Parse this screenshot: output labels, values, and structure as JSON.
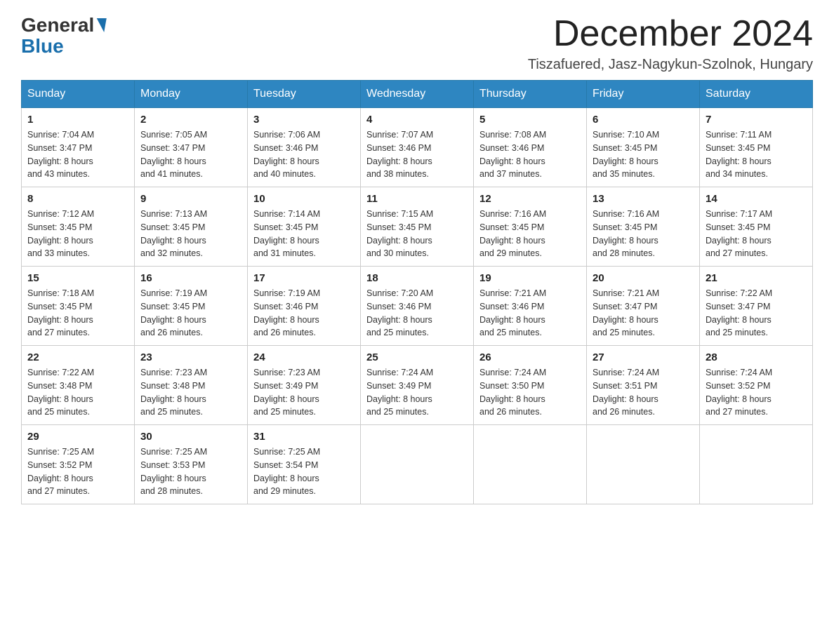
{
  "header": {
    "logo_general": "General",
    "logo_blue": "Blue",
    "month_title": "December 2024",
    "location": "Tiszafuered, Jasz-Nagykun-Szolnok, Hungary"
  },
  "weekdays": [
    "Sunday",
    "Monday",
    "Tuesday",
    "Wednesday",
    "Thursday",
    "Friday",
    "Saturday"
  ],
  "weeks": [
    [
      {
        "day": "1",
        "sunrise": "7:04 AM",
        "sunset": "3:47 PM",
        "daylight": "8 hours and 43 minutes."
      },
      {
        "day": "2",
        "sunrise": "7:05 AM",
        "sunset": "3:47 PM",
        "daylight": "8 hours and 41 minutes."
      },
      {
        "day": "3",
        "sunrise": "7:06 AM",
        "sunset": "3:46 PM",
        "daylight": "8 hours and 40 minutes."
      },
      {
        "day": "4",
        "sunrise": "7:07 AM",
        "sunset": "3:46 PM",
        "daylight": "8 hours and 38 minutes."
      },
      {
        "day": "5",
        "sunrise": "7:08 AM",
        "sunset": "3:46 PM",
        "daylight": "8 hours and 37 minutes."
      },
      {
        "day": "6",
        "sunrise": "7:10 AM",
        "sunset": "3:45 PM",
        "daylight": "8 hours and 35 minutes."
      },
      {
        "day": "7",
        "sunrise": "7:11 AM",
        "sunset": "3:45 PM",
        "daylight": "8 hours and 34 minutes."
      }
    ],
    [
      {
        "day": "8",
        "sunrise": "7:12 AM",
        "sunset": "3:45 PM",
        "daylight": "8 hours and 33 minutes."
      },
      {
        "day": "9",
        "sunrise": "7:13 AM",
        "sunset": "3:45 PM",
        "daylight": "8 hours and 32 minutes."
      },
      {
        "day": "10",
        "sunrise": "7:14 AM",
        "sunset": "3:45 PM",
        "daylight": "8 hours and 31 minutes."
      },
      {
        "day": "11",
        "sunrise": "7:15 AM",
        "sunset": "3:45 PM",
        "daylight": "8 hours and 30 minutes."
      },
      {
        "day": "12",
        "sunrise": "7:16 AM",
        "sunset": "3:45 PM",
        "daylight": "8 hours and 29 minutes."
      },
      {
        "day": "13",
        "sunrise": "7:16 AM",
        "sunset": "3:45 PM",
        "daylight": "8 hours and 28 minutes."
      },
      {
        "day": "14",
        "sunrise": "7:17 AM",
        "sunset": "3:45 PM",
        "daylight": "8 hours and 27 minutes."
      }
    ],
    [
      {
        "day": "15",
        "sunrise": "7:18 AM",
        "sunset": "3:45 PM",
        "daylight": "8 hours and 27 minutes."
      },
      {
        "day": "16",
        "sunrise": "7:19 AM",
        "sunset": "3:45 PM",
        "daylight": "8 hours and 26 minutes."
      },
      {
        "day": "17",
        "sunrise": "7:19 AM",
        "sunset": "3:46 PM",
        "daylight": "8 hours and 26 minutes."
      },
      {
        "day": "18",
        "sunrise": "7:20 AM",
        "sunset": "3:46 PM",
        "daylight": "8 hours and 25 minutes."
      },
      {
        "day": "19",
        "sunrise": "7:21 AM",
        "sunset": "3:46 PM",
        "daylight": "8 hours and 25 minutes."
      },
      {
        "day": "20",
        "sunrise": "7:21 AM",
        "sunset": "3:47 PM",
        "daylight": "8 hours and 25 minutes."
      },
      {
        "day": "21",
        "sunrise": "7:22 AM",
        "sunset": "3:47 PM",
        "daylight": "8 hours and 25 minutes."
      }
    ],
    [
      {
        "day": "22",
        "sunrise": "7:22 AM",
        "sunset": "3:48 PM",
        "daylight": "8 hours and 25 minutes."
      },
      {
        "day": "23",
        "sunrise": "7:23 AM",
        "sunset": "3:48 PM",
        "daylight": "8 hours and 25 minutes."
      },
      {
        "day": "24",
        "sunrise": "7:23 AM",
        "sunset": "3:49 PM",
        "daylight": "8 hours and 25 minutes."
      },
      {
        "day": "25",
        "sunrise": "7:24 AM",
        "sunset": "3:49 PM",
        "daylight": "8 hours and 25 minutes."
      },
      {
        "day": "26",
        "sunrise": "7:24 AM",
        "sunset": "3:50 PM",
        "daylight": "8 hours and 26 minutes."
      },
      {
        "day": "27",
        "sunrise": "7:24 AM",
        "sunset": "3:51 PM",
        "daylight": "8 hours and 26 minutes."
      },
      {
        "day": "28",
        "sunrise": "7:24 AM",
        "sunset": "3:52 PM",
        "daylight": "8 hours and 27 minutes."
      }
    ],
    [
      {
        "day": "29",
        "sunrise": "7:25 AM",
        "sunset": "3:52 PM",
        "daylight": "8 hours and 27 minutes."
      },
      {
        "day": "30",
        "sunrise": "7:25 AM",
        "sunset": "3:53 PM",
        "daylight": "8 hours and 28 minutes."
      },
      {
        "day": "31",
        "sunrise": "7:25 AM",
        "sunset": "3:54 PM",
        "daylight": "8 hours and 29 minutes."
      },
      null,
      null,
      null,
      null
    ]
  ],
  "labels": {
    "sunrise": "Sunrise:",
    "sunset": "Sunset:",
    "daylight": "Daylight:"
  }
}
